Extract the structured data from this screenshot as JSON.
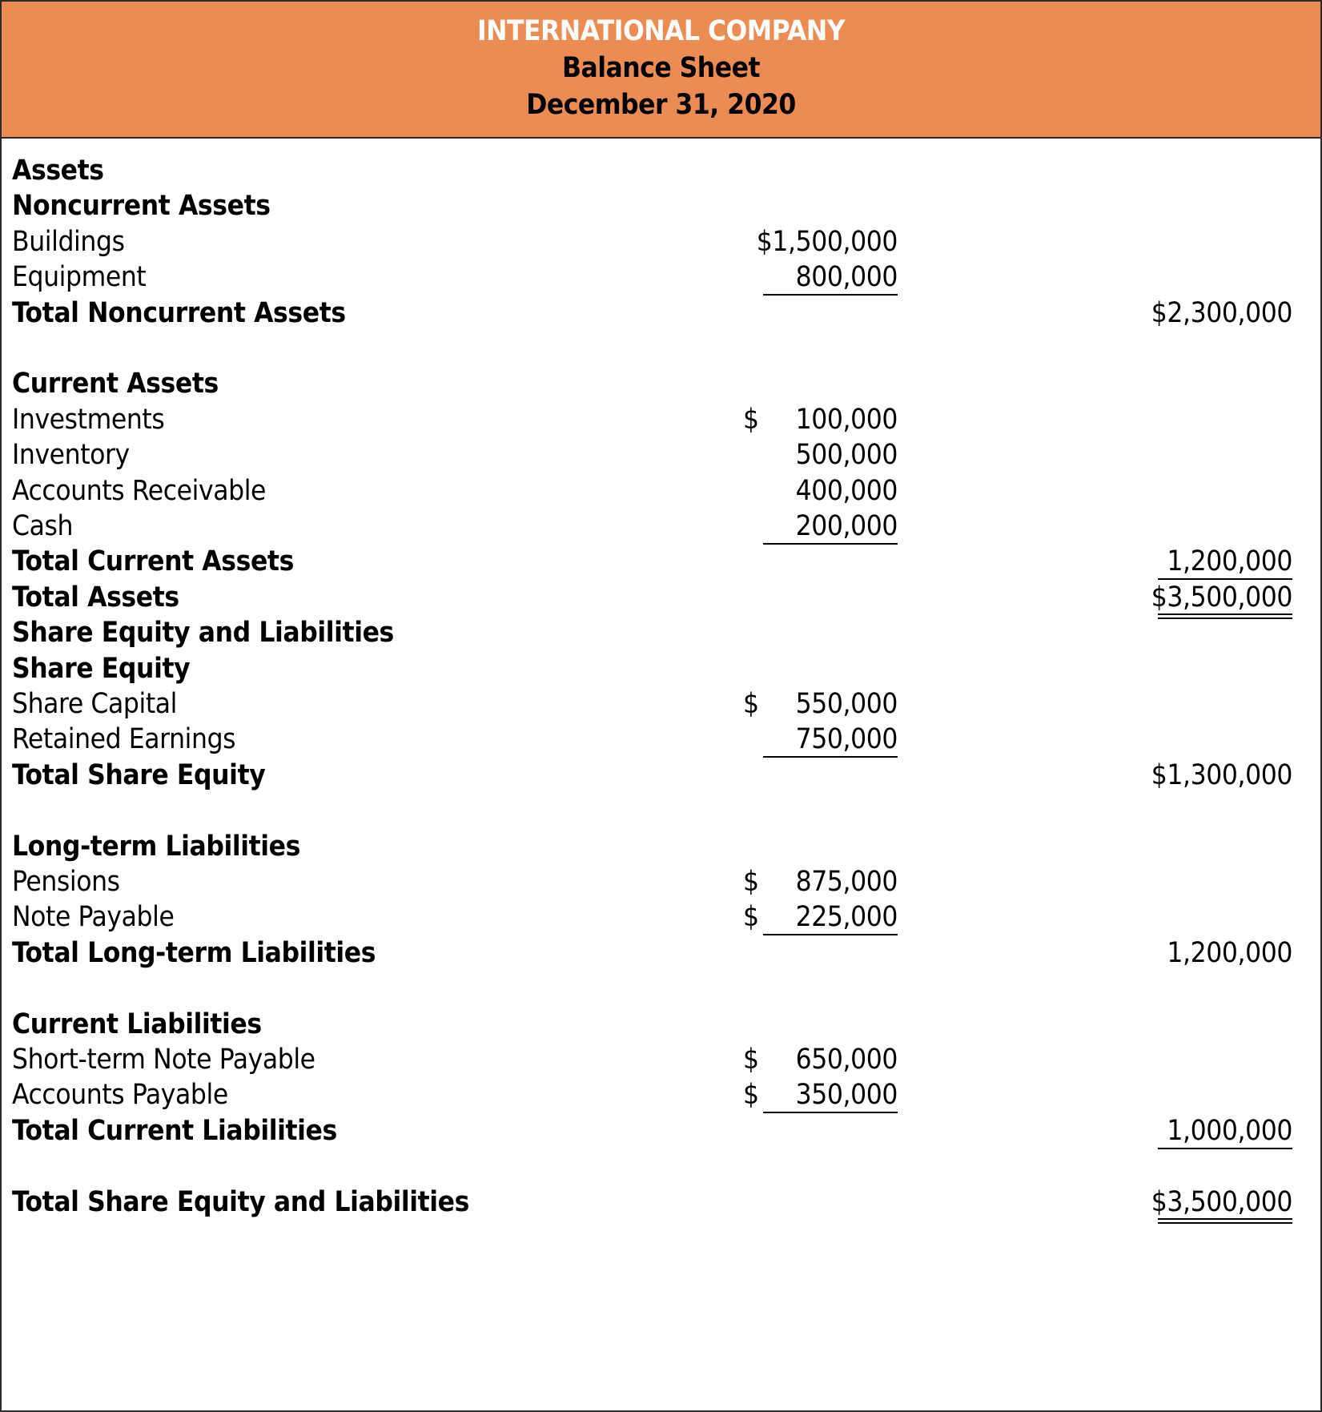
{
  "header": {
    "company": "INTERNATIONAL COMPANY",
    "statement": "Balance Sheet",
    "date": "December 31, 2020",
    "background_color": "#eb8c55"
  },
  "rows": [
    {
      "label": "Assets",
      "bold": true
    },
    {
      "label": "Noncurrent Assets",
      "bold": true
    },
    {
      "label": "Buildings",
      "mid": "$1,500,000"
    },
    {
      "label": "Equipment",
      "mid": "800,000",
      "mid_underline": "single"
    },
    {
      "label": "Total Noncurrent Assets",
      "bold": true,
      "right": "$2,300,000"
    },
    {
      "label": "",
      "spacer": true
    },
    {
      "label": "Current Assets",
      "bold": true
    },
    {
      "label": "Investments",
      "mid_currency": "$",
      "mid": "100,000"
    },
    {
      "label": "Inventory",
      "mid": "500,000"
    },
    {
      "label": "Accounts Receivable",
      "mid": "400,000"
    },
    {
      "label": "Cash",
      "mid": "200,000",
      "mid_underline": "single"
    },
    {
      "label": "Total Current Assets",
      "bold": true,
      "right": "1,200,000",
      "right_underline": "single"
    },
    {
      "label": "Total Assets",
      "bold": true,
      "right": "$3,500,000",
      "right_underline": "double"
    },
    {
      "label": "Share Equity and Liabilities",
      "bold": true
    },
    {
      "label": "Share Equity",
      "bold": true
    },
    {
      "label": "Share Capital",
      "mid_currency": "$",
      "mid": "550,000"
    },
    {
      "label": "Retained Earnings",
      "mid": "750,000",
      "mid_underline": "single"
    },
    {
      "label": "Total Share Equity",
      "bold": true,
      "right": "$1,300,000"
    },
    {
      "label": "",
      "spacer": true
    },
    {
      "label": "Long-term Liabilities",
      "bold": true
    },
    {
      "label": "Pensions",
      "mid_currency": "$",
      "mid": "875,000"
    },
    {
      "label": "Note Payable",
      "mid_currency": "$",
      "mid": "225,000",
      "mid_underline": "single"
    },
    {
      "label": "Total Long-term Liabilities",
      "bold": true,
      "right": "1,200,000"
    },
    {
      "label": "",
      "spacer": true
    },
    {
      "label": "Current Liabilities",
      "bold": true
    },
    {
      "label": "Short-term Note Payable",
      "mid_currency": "$",
      "mid": "650,000"
    },
    {
      "label": "Accounts Payable",
      "mid_currency": "$",
      "mid": "350,000",
      "mid_underline": "single"
    },
    {
      "label": "Total Current Liabilities",
      "bold": true,
      "right": "1,000,000",
      "right_underline": "single"
    },
    {
      "label": "",
      "spacer": true
    },
    {
      "label": "Total Share Equity and Liabilities",
      "bold": true,
      "right": "$3,500,000",
      "right_underline": "double"
    }
  ]
}
